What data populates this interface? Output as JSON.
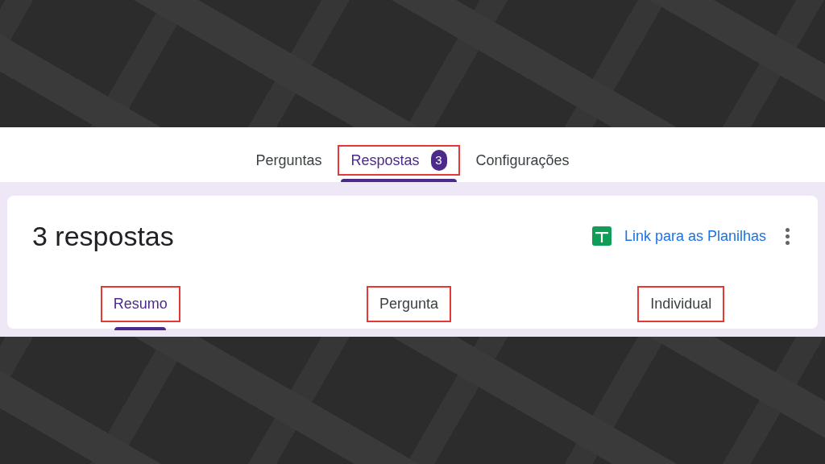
{
  "tabs": [
    {
      "label": "Perguntas",
      "selected": false,
      "highlighted": false
    },
    {
      "label": "Respostas",
      "selected": true,
      "highlighted": true,
      "count": "3"
    },
    {
      "label": "Configurações",
      "selected": false,
      "highlighted": false
    }
  ],
  "responses": {
    "title": "3 respostas",
    "sheets_link": "Link para as Planilhas",
    "subtabs": [
      {
        "label": "Resumo",
        "selected": true,
        "highlighted": true
      },
      {
        "label": "Pergunta",
        "selected": false,
        "highlighted": true
      },
      {
        "label": "Individual",
        "selected": false,
        "highlighted": true
      }
    ]
  }
}
